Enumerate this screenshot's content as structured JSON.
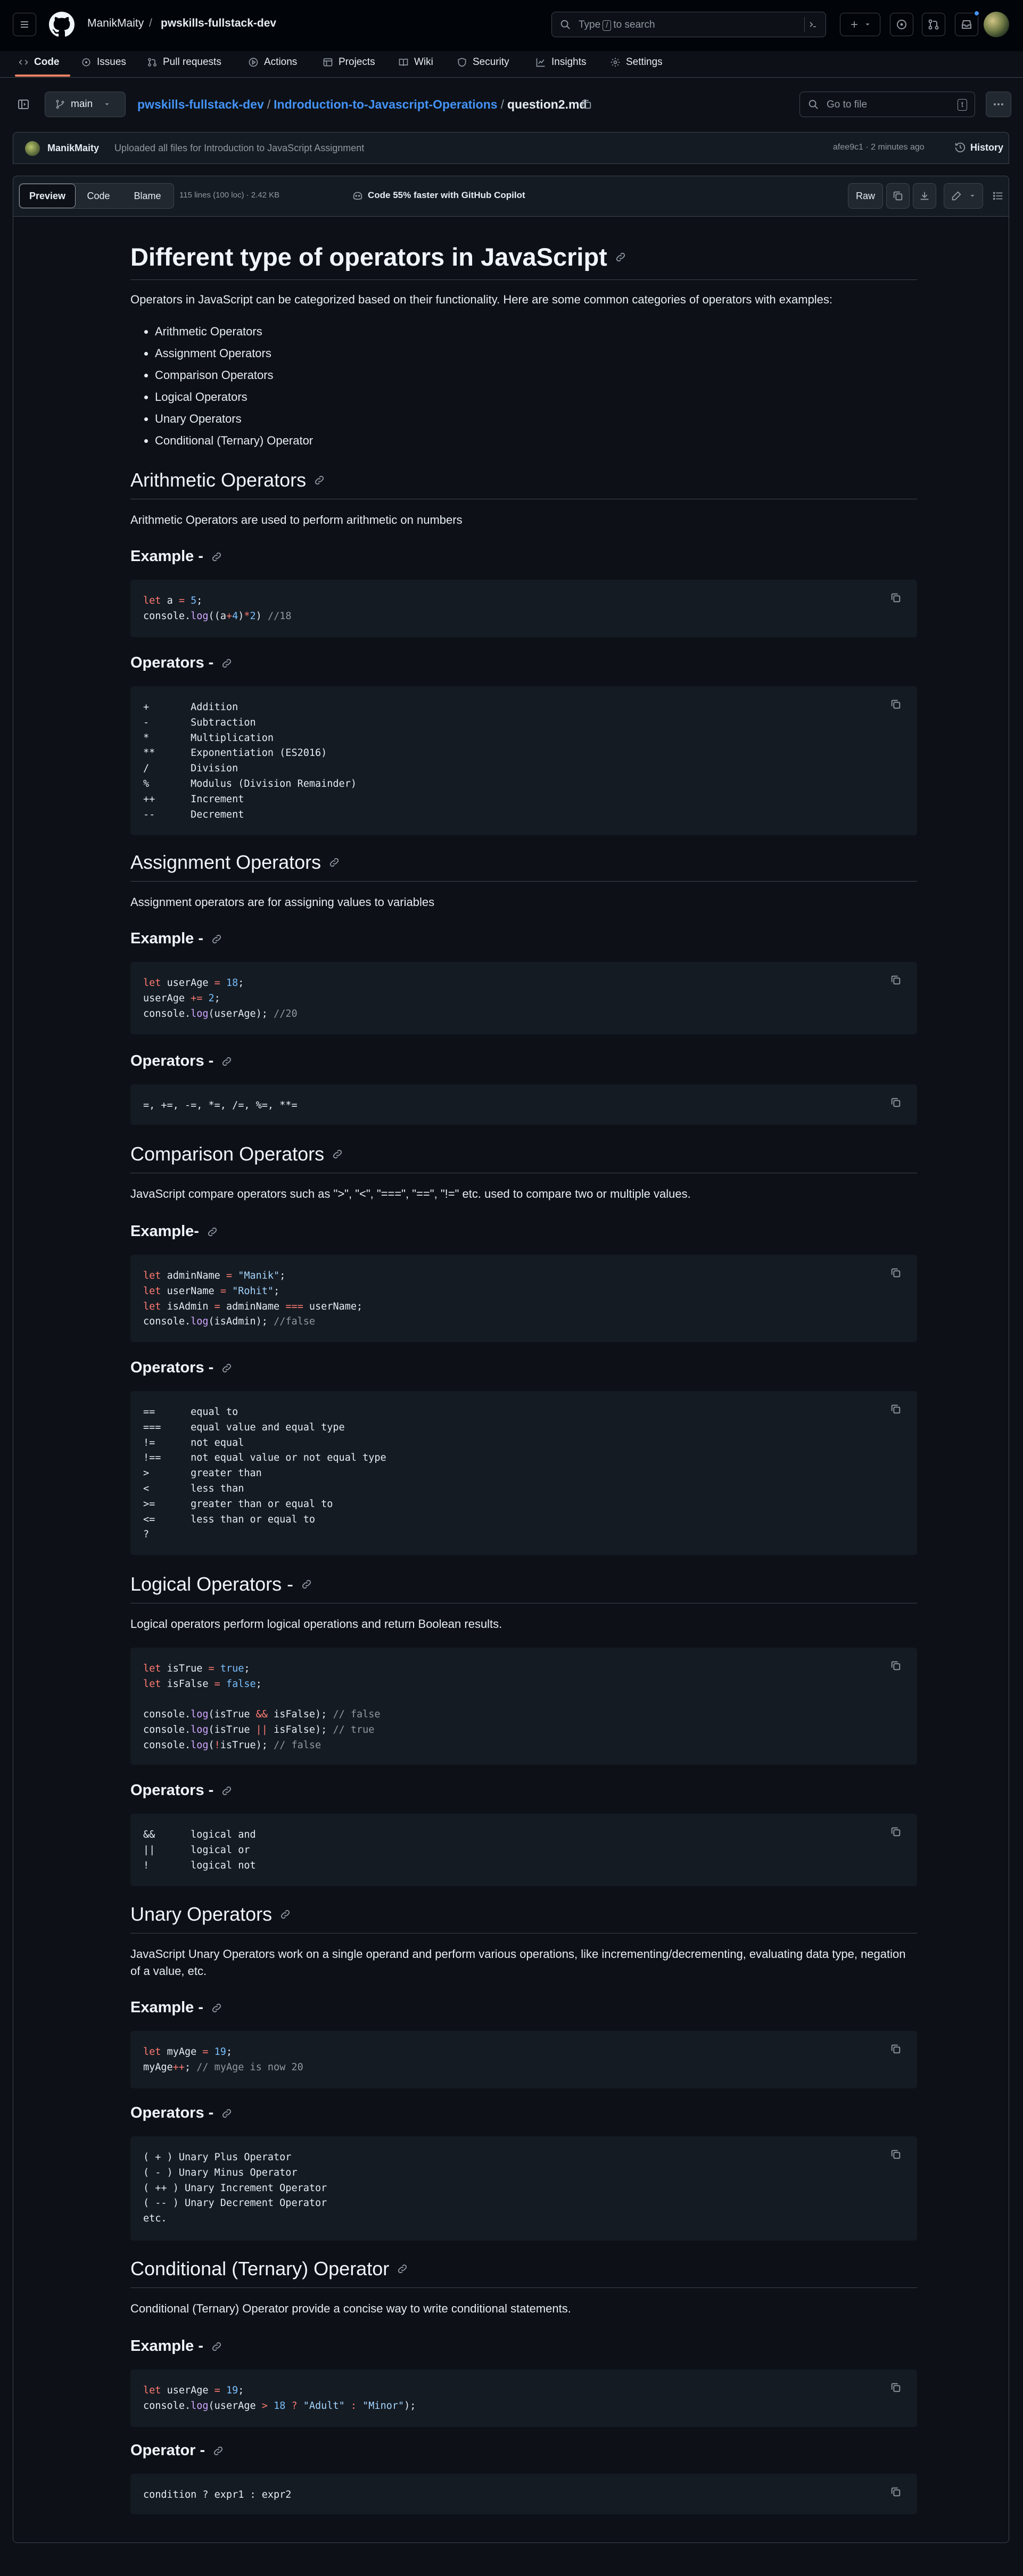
{
  "header": {
    "owner": "ManikMaity",
    "repo": "pwskills-fullstack-dev",
    "search_placeholder_before": "Type",
    "search_key": "/",
    "search_placeholder_after": "to search"
  },
  "repo_nav": {
    "tabs": [
      "Code",
      "Issues",
      "Pull requests",
      "Actions",
      "Projects",
      "Wiki",
      "Security",
      "Insights",
      "Settings"
    ]
  },
  "file_header": {
    "branch": "main",
    "breadcrumb_repo": "pwskills-fullstack-dev",
    "breadcrumb_folder": "Indroduction-to-Javascript-Operations",
    "breadcrumb_file": "question2.md",
    "goto_placeholder": "Go to file",
    "goto_key": "t"
  },
  "commit": {
    "author": "ManikMaity",
    "message": "Uploaded all files for Introduction to JavaScript Assignment",
    "meta": "afee9c1 · 2 minutes ago",
    "history_label": "History"
  },
  "toolbar": {
    "preview_label": "Preview",
    "code_label": "Code",
    "blame_label": "Blame",
    "stats": "115 lines (100 loc) · 2.42 KB",
    "copilot_note": "Code 55% faster with GitHub Copilot",
    "raw_label": "Raw"
  },
  "doc": {
    "title": "Different type of operators in JavaScript",
    "intro": "Operators in JavaScript can be categorized based on their functionality. Here are some common categories of operators with examples:",
    "categories": [
      "Arithmetic Operators",
      "Assignment Operators",
      "Comparison Operators",
      "Logical Operators",
      "Unary Operators",
      "Conditional (Ternary) Operator"
    ],
    "arithmetic": {
      "heading": "Arithmetic Operators",
      "desc": "Arithmetic Operators are used to perform arithmetic on numbers",
      "example_heading": "Example -",
      "operators_heading": "Operators -",
      "operators_code": "+       Addition\n-       Subtraction\n*       Multiplication\n**      Exponentiation (ES2016)\n/       Division\n%       Modulus (Division Remainder)\n++      Increment\n--      Decrement"
    },
    "assignment": {
      "heading": "Assignment Operators",
      "desc": "Assignment operators are for assigning values to variables",
      "example_heading": "Example -",
      "operators_heading": "Operators -",
      "operators_code": "=, +=, -=, *=, /=, %=, **="
    },
    "comparison": {
      "heading": "Comparison Operators",
      "desc": "JavaScript compare operators such as \">\", \"<\", \"===\", \"==\", \"!=\" etc. used to compare two or multiple values.",
      "example_heading": "Example-",
      "operators_heading": "Operators -",
      "operators_code": "==      equal to\n===     equal value and equal type\n!=      not equal\n!==     not equal value or not equal type\n>       greater than\n<       less than\n>=      greater than or equal to\n<=      less than or equal to\n?"
    },
    "logical": {
      "heading": "Logical Operators -",
      "desc": "Logical operators perform logical operations and return Boolean results.",
      "operators_heading": "Operators -",
      "operators_code": "&&      logical and\n||      logical or\n!       logical not"
    },
    "unary": {
      "heading": "Unary Operators",
      "desc": "JavaScript Unary Operators work on a single operand and perform various operations, like incrementing/decrementing, evaluating data type, negation of a value, etc.",
      "example_heading": "Example -",
      "operators_heading": "Operators -",
      "operators_code": "( + ) Unary Plus Operator\n( - ) Unary Minus Operator\n( ++ ) Unary Increment Operator\n( -- ) Unary Decrement Operator\netc."
    },
    "ternary": {
      "heading": "Conditional (Ternary) Operator",
      "desc": "Conditional (Ternary) Operator provide a concise way to write conditional statements.",
      "example_heading": "Example -",
      "operator_heading": "Operator -",
      "operator_code": "condition ? expr1 : expr2"
    }
  },
  "code_samples": {
    "arithmetic": [
      [
        [
          "k",
          "let "
        ],
        [
          "t",
          "a "
        ],
        [
          "k",
          "= "
        ],
        [
          "n",
          "5"
        ],
        [
          "t",
          ";"
        ]
      ],
      [
        [
          "t",
          "console."
        ],
        [
          "f",
          "log"
        ],
        [
          "t",
          "(("
        ],
        [
          "t",
          "a"
        ],
        [
          "k",
          "+"
        ],
        [
          "n",
          "4"
        ],
        [
          "t",
          ")"
        ],
        [
          "k",
          "*"
        ],
        [
          "n",
          "2"
        ],
        [
          "t",
          ") "
        ],
        [
          "c",
          "//18"
        ]
      ]
    ],
    "assignment": [
      [
        [
          "k",
          "let "
        ],
        [
          "t",
          "userAge "
        ],
        [
          "k",
          "= "
        ],
        [
          "n",
          "18"
        ],
        [
          "t",
          ";"
        ]
      ],
      [
        [
          "t",
          "userAge "
        ],
        [
          "k",
          "+= "
        ],
        [
          "n",
          "2"
        ],
        [
          "t",
          ";"
        ]
      ],
      [
        [
          "t",
          "console."
        ],
        [
          "f",
          "log"
        ],
        [
          "t",
          "(userAge); "
        ],
        [
          "c",
          "//20"
        ]
      ]
    ],
    "comparison": [
      [
        [
          "k",
          "let "
        ],
        [
          "t",
          "adminName "
        ],
        [
          "k",
          "= "
        ],
        [
          "s",
          "\"Manik\""
        ],
        [
          "t",
          ";"
        ]
      ],
      [
        [
          "k",
          "let "
        ],
        [
          "t",
          "userName "
        ],
        [
          "k",
          "= "
        ],
        [
          "s",
          "\"Rohit\""
        ],
        [
          "t",
          ";"
        ]
      ],
      [
        [
          "k",
          "let "
        ],
        [
          "t",
          "isAdmin "
        ],
        [
          "k",
          "= "
        ],
        [
          "t",
          "adminName "
        ],
        [
          "k",
          "=== "
        ],
        [
          "t",
          "userName;"
        ]
      ],
      [
        [
          "t",
          "console."
        ],
        [
          "f",
          "log"
        ],
        [
          "t",
          "(isAdmin); "
        ],
        [
          "c",
          "//false"
        ]
      ]
    ],
    "logical": [
      [
        [
          "k",
          "let "
        ],
        [
          "t",
          "isTrue "
        ],
        [
          "k",
          "= "
        ],
        [
          "n",
          "true"
        ],
        [
          "t",
          ";"
        ]
      ],
      [
        [
          "k",
          "let "
        ],
        [
          "t",
          "isFalse "
        ],
        [
          "k",
          "= "
        ],
        [
          "n",
          "false"
        ],
        [
          "t",
          ";"
        ]
      ],
      [],
      [
        [
          "t",
          "console."
        ],
        [
          "f",
          "log"
        ],
        [
          "t",
          "(isTrue "
        ],
        [
          "k",
          "&& "
        ],
        [
          "t",
          "isFalse); "
        ],
        [
          "c",
          "// false"
        ]
      ],
      [
        [
          "t",
          "console."
        ],
        [
          "f",
          "log"
        ],
        [
          "t",
          "(isTrue "
        ],
        [
          "k",
          "|| "
        ],
        [
          "t",
          "isFalse); "
        ],
        [
          "c",
          "// true"
        ]
      ],
      [
        [
          "t",
          "console."
        ],
        [
          "f",
          "log"
        ],
        [
          "t",
          "("
        ],
        [
          "k",
          "!"
        ],
        [
          "t",
          "isTrue); "
        ],
        [
          "c",
          "// false"
        ]
      ]
    ],
    "unary": [
      [
        [
          "k",
          "let "
        ],
        [
          "t",
          "myAge "
        ],
        [
          "k",
          "= "
        ],
        [
          "n",
          "19"
        ],
        [
          "t",
          ";"
        ]
      ],
      [
        [
          "t",
          "myAge"
        ],
        [
          "k",
          "++"
        ],
        [
          "t",
          "; "
        ],
        [
          "c",
          "// myAge is now 20"
        ]
      ]
    ],
    "ternary": [
      [
        [
          "k",
          "let "
        ],
        [
          "t",
          "userAge "
        ],
        [
          "k",
          "= "
        ],
        [
          "n",
          "19"
        ],
        [
          "t",
          ";"
        ]
      ],
      [
        [
          "t",
          "console."
        ],
        [
          "f",
          "log"
        ],
        [
          "t",
          "(userAge "
        ],
        [
          "k",
          "> "
        ],
        [
          "n",
          "18 "
        ],
        [
          "k",
          "? "
        ],
        [
          "s",
          "\"Adult\" "
        ],
        [
          "k",
          ": "
        ],
        [
          "s",
          "\"Minor\""
        ],
        [
          "t",
          ");"
        ]
      ]
    ]
  },
  "colors": {
    "page_bg": "#0d1117",
    "header_bg": "#010409",
    "accent_link": "#4493f8",
    "tab_underline": "#f78166",
    "syntax_keyword": "#ff7b72",
    "syntax_number": "#79c0ff",
    "syntax_string": "#a5d6ff",
    "syntax_function": "#d2a8ff"
  }
}
